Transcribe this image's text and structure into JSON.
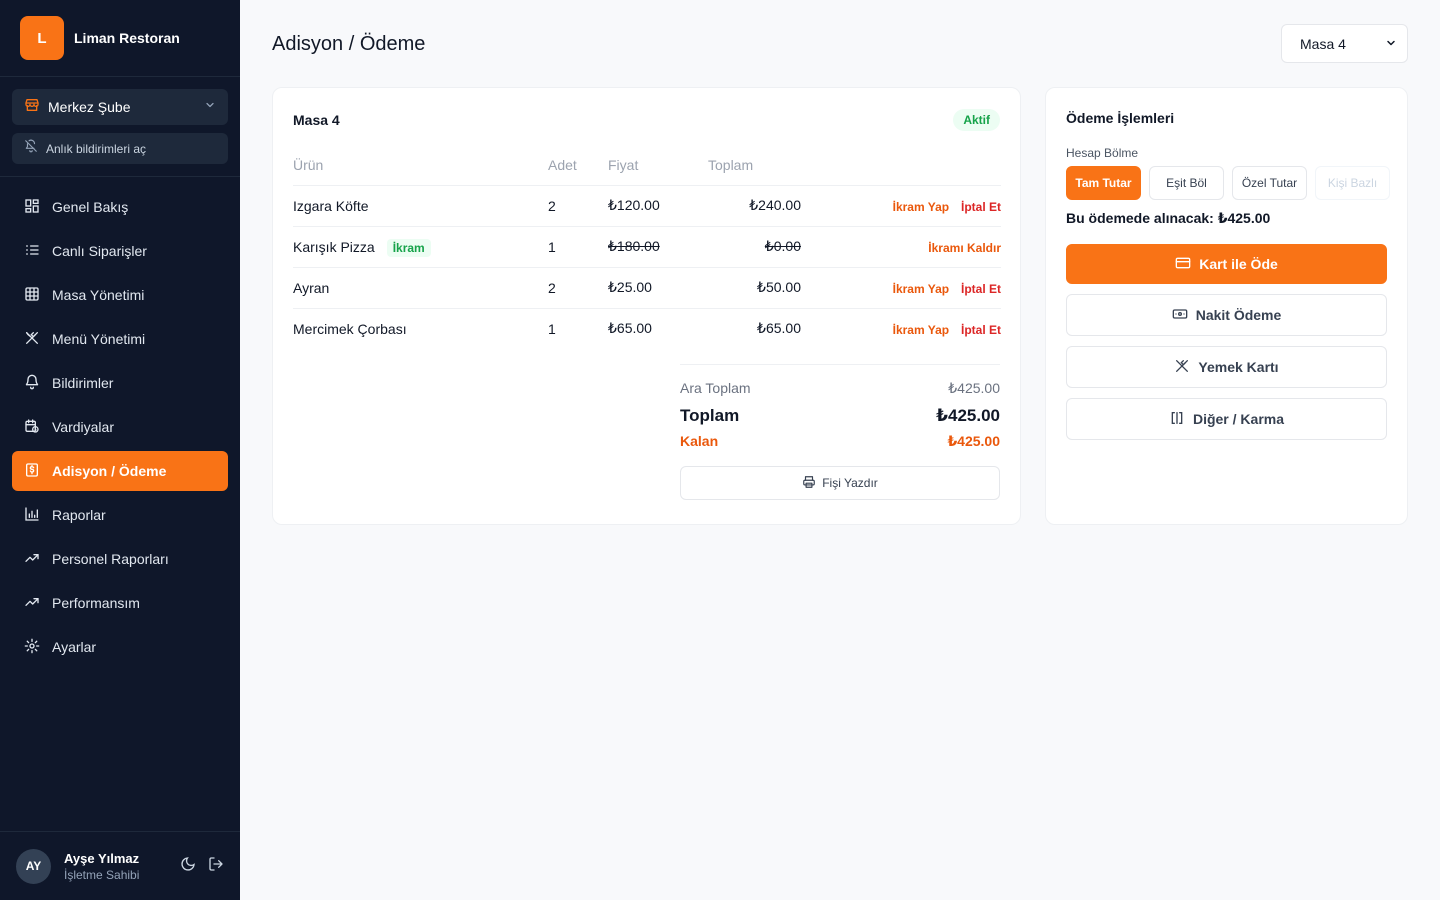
{
  "brand": {
    "logo_letter": "L",
    "name": "Liman Restoran"
  },
  "branch": {
    "label": "Merkez Şube",
    "notif_label": "Anlık bildirimleri aç"
  },
  "nav": [
    {
      "label": "Genel Bakış",
      "icon": "dashboard-icon"
    },
    {
      "label": "Canlı Siparişler",
      "icon": "list-icon"
    },
    {
      "label": "Masa Yönetimi",
      "icon": "grid-icon"
    },
    {
      "label": "Menü Yönetimi",
      "icon": "utensils-icon"
    },
    {
      "label": "Bildirimler",
      "icon": "bell-icon"
    },
    {
      "label": "Vardiyalar",
      "icon": "calendar-clock-icon"
    },
    {
      "label": "Adisyon / Ödeme",
      "icon": "receipt-icon",
      "active": true
    },
    {
      "label": "Raporlar",
      "icon": "bar-chart-icon"
    },
    {
      "label": "Personel Raporları",
      "icon": "trend-icon"
    },
    {
      "label": "Performansım",
      "icon": "trend-icon"
    },
    {
      "label": "Ayarlar",
      "icon": "gear-icon"
    }
  ],
  "user": {
    "initials": "AY",
    "name": "Ayşe Yılmaz",
    "role": "İşletme Sahibi"
  },
  "page": {
    "title": "Adisyon / Ödeme",
    "table_select": "Masa 4"
  },
  "order": {
    "table": "Masa 4",
    "status": "Aktif",
    "columns": {
      "name": "Ürün",
      "qty": "Adet",
      "price": "Fiyat",
      "total": "Toplam"
    },
    "items": [
      {
        "name": "Izgara Köfte",
        "qty": "2",
        "price": "₺120.00",
        "total": "₺240.00",
        "action1": "İkram Yap",
        "action2": "İptal Et"
      },
      {
        "name": "Karışık Pizza",
        "badge": "İkram",
        "qty": "1",
        "price": "₺180.00",
        "total": "₺0.00",
        "action1": "İkramı Kaldır"
      },
      {
        "name": "Ayran",
        "qty": "2",
        "price": "₺25.00",
        "total": "₺50.00",
        "action1": "İkram Yap",
        "action2": "İptal Et"
      },
      {
        "name": "Mercimek Çorbası",
        "qty": "1",
        "price": "₺65.00",
        "total": "₺65.00",
        "action1": "İkram Yap",
        "action2": "İptal Et"
      }
    ],
    "summary": {
      "subtotal_label": "Ara Toplam",
      "subtotal": "₺425.00",
      "total_label": "Toplam",
      "total": "₺425.00",
      "remaining_label": "Kalan",
      "remaining": "₺425.00"
    },
    "print_label": "Fişi Yazdır"
  },
  "payment": {
    "title": "Ödeme İşlemleri",
    "split_label": "Hesap Bölme",
    "split_options": [
      "Tam Tutar",
      "Eşit Böl",
      "Özel Tutar",
      "Kişi Bazlı"
    ],
    "collect_text": "Bu ödemede alınacak: ₺425.00",
    "buttons": [
      "Kart ile Öde",
      "Nakit Ödeme",
      "Yemek Kartı",
      "Diğer / Karma"
    ]
  },
  "colors": {
    "accent": "#f97316",
    "sidebar": "#0f172a",
    "success": "#16a34a",
    "danger": "#dc2626"
  }
}
